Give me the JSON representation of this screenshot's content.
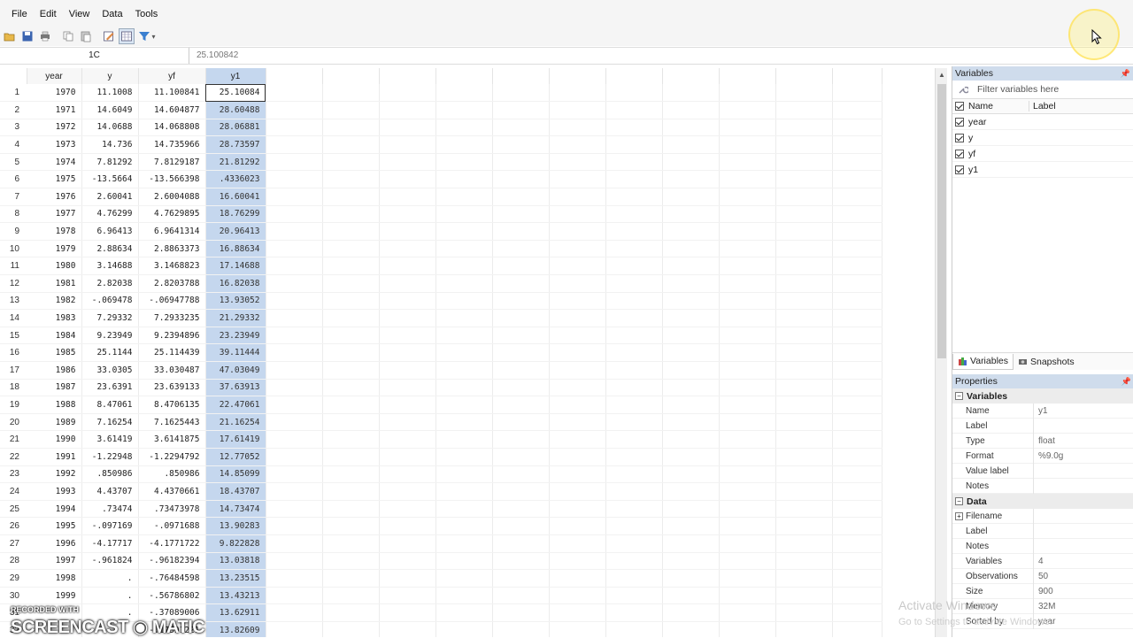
{
  "menu": [
    "File",
    "Edit",
    "View",
    "Data",
    "Tools"
  ],
  "toolbar": {
    "icons": [
      "open-icon",
      "save-icon",
      "print-icon",
      "copy-icon",
      "paste-icon",
      "edit-icon",
      "browse-icon",
      "filter-icon"
    ]
  },
  "refbar": {
    "cell_ref": "1C",
    "cell_value": "25.100842"
  },
  "grid": {
    "columns": [
      "year",
      "y",
      "yf",
      "y1"
    ],
    "selected_column": "y1",
    "rows": [
      [
        "1",
        "1970",
        "11.1008",
        "11.100841",
        "25.10084"
      ],
      [
        "2",
        "1971",
        "14.6049",
        "14.604877",
        "28.60488"
      ],
      [
        "3",
        "1972",
        "14.0688",
        "14.068808",
        "28.06881"
      ],
      [
        "4",
        "1973",
        "14.736",
        "14.735966",
        "28.73597"
      ],
      [
        "5",
        "1974",
        "7.81292",
        "7.8129187",
        "21.81292"
      ],
      [
        "6",
        "1975",
        "-13.5664",
        "-13.566398",
        ".4336023"
      ],
      [
        "7",
        "1976",
        "2.60041",
        "2.6004088",
        "16.60041"
      ],
      [
        "8",
        "1977",
        "4.76299",
        "4.7629895",
        "18.76299"
      ],
      [
        "9",
        "1978",
        "6.96413",
        "6.9641314",
        "20.96413"
      ],
      [
        "10",
        "1979",
        "2.88634",
        "2.8863373",
        "16.88634"
      ],
      [
        "11",
        "1980",
        "3.14688",
        "3.1468823",
        "17.14688"
      ],
      [
        "12",
        "1981",
        "2.82038",
        "2.8203788",
        "16.82038"
      ],
      [
        "13",
        "1982",
        "-.069478",
        "-.06947788",
        "13.93052"
      ],
      [
        "14",
        "1983",
        "7.29332",
        "7.2933235",
        "21.29332"
      ],
      [
        "15",
        "1984",
        "9.23949",
        "9.2394896",
        "23.23949"
      ],
      [
        "16",
        "1985",
        "25.1144",
        "25.114439",
        "39.11444"
      ],
      [
        "17",
        "1986",
        "33.0305",
        "33.030487",
        "47.03049"
      ],
      [
        "18",
        "1987",
        "23.6391",
        "23.639133",
        "37.63913"
      ],
      [
        "19",
        "1988",
        "8.47061",
        "8.4706135",
        "22.47061"
      ],
      [
        "20",
        "1989",
        "7.16254",
        "7.1625443",
        "21.16254"
      ],
      [
        "21",
        "1990",
        "3.61419",
        "3.6141875",
        "17.61419"
      ],
      [
        "22",
        "1991",
        "-1.22948",
        "-1.2294792",
        "12.77052"
      ],
      [
        "23",
        "1992",
        ".850986",
        ".850986",
        "14.85099"
      ],
      [
        "24",
        "1993",
        "4.43707",
        "4.4370661",
        "18.43707"
      ],
      [
        "25",
        "1994",
        ".73474",
        ".73473978",
        "14.73474"
      ],
      [
        "26",
        "1995",
        "-.097169",
        "-.0971688",
        "13.90283"
      ],
      [
        "27",
        "1996",
        "-4.17717",
        "-4.1771722",
        "9.822828"
      ],
      [
        "28",
        "1997",
        "-.961824",
        "-.96182394",
        "13.03818"
      ],
      [
        "29",
        "1998",
        ".",
        "-.76484598",
        "13.23515"
      ],
      [
        "30",
        "1999",
        ".",
        "-.56786802",
        "13.43213"
      ],
      [
        "31",
        "",
        ".",
        "-.37089006",
        "13.62911"
      ],
      [
        "32",
        "",
        "",
        "-.17391221",
        "13.82609"
      ]
    ]
  },
  "variables_panel": {
    "title": "Variables",
    "filter_placeholder": "Filter variables here",
    "col_name": "Name",
    "col_label": "Label",
    "items": [
      "year",
      "y",
      "yf",
      "y1"
    ],
    "tab_variables": "Variables",
    "tab_snapshots": "Snapshots"
  },
  "properties_panel": {
    "title": "Properties",
    "section_variables": "Variables",
    "variables": [
      {
        "k": "Name",
        "v": "y1"
      },
      {
        "k": "Label",
        "v": ""
      },
      {
        "k": "Type",
        "v": "float"
      },
      {
        "k": "Format",
        "v": "%9.0g"
      },
      {
        "k": "Value label",
        "v": ""
      },
      {
        "k": "Notes",
        "v": ""
      }
    ],
    "section_data": "Data",
    "data": [
      {
        "k": "Filename",
        "v": ""
      },
      {
        "k": "Label",
        "v": ""
      },
      {
        "k": "Notes",
        "v": ""
      },
      {
        "k": "Variables",
        "v": "4"
      },
      {
        "k": "Observations",
        "v": "50"
      },
      {
        "k": "Size",
        "v": "900"
      },
      {
        "k": "Memory",
        "v": "32M"
      },
      {
        "k": "Sorted by",
        "v": "year"
      }
    ]
  },
  "overlay": {
    "activate_title": "Activate Windows",
    "activate_sub": "Go to Settings to activate Windows.",
    "recorded_with": "RECORDED WITH",
    "screencast": "SCREENCAST ◉ MATIC"
  }
}
